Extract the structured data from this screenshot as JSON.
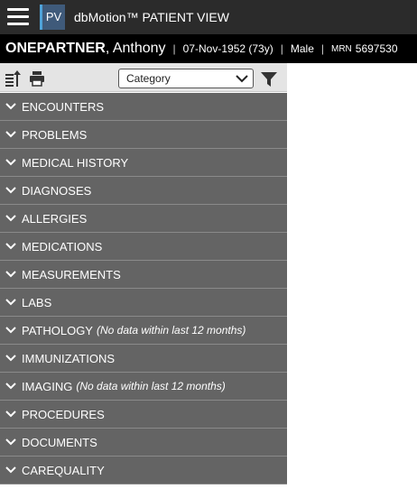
{
  "app": {
    "logo_text": "PV",
    "title": "dbMotion™ PATIENT VIEW"
  },
  "patient": {
    "last_name": "ONEPARTNER",
    "first_name": ", Anthony",
    "dob": "07-Nov-1952 (73y)",
    "sex": "Male",
    "mrn_label": "MRN",
    "mrn": "5697530",
    "separator": "|"
  },
  "toolbar": {
    "category_value": "Category"
  },
  "sections": [
    {
      "label": "ENCOUNTERS",
      "note": ""
    },
    {
      "label": "PROBLEMS",
      "note": ""
    },
    {
      "label": "MEDICAL HISTORY",
      "note": ""
    },
    {
      "label": "DIAGNOSES",
      "note": ""
    },
    {
      "label": "ALLERGIES",
      "note": ""
    },
    {
      "label": "MEDICATIONS",
      "note": ""
    },
    {
      "label": "MEASUREMENTS",
      "note": ""
    },
    {
      "label": "LABS",
      "note": ""
    },
    {
      "label": "PATHOLOGY",
      "note": "(No data within last 12 months)"
    },
    {
      "label": "IMMUNIZATIONS",
      "note": ""
    },
    {
      "label": "IMAGING",
      "note": "(No data within last 12 months)"
    },
    {
      "label": "PROCEDURES",
      "note": ""
    },
    {
      "label": "DOCUMENTS",
      "note": ""
    },
    {
      "label": "CAREQUALITY",
      "note": ""
    }
  ],
  "colors": {
    "app_bar": "#2b2b2b",
    "patient_bar": "#000000",
    "section_row": "#646464",
    "toolbar": "#e4e4e4"
  },
  "icons": [
    "menu-icon",
    "sort-icon",
    "print-icon",
    "chevron-down-icon",
    "filter-icon"
  ]
}
